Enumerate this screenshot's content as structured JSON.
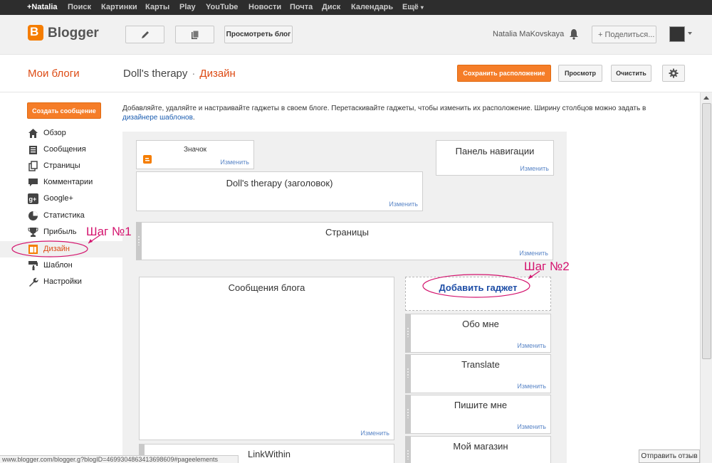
{
  "google_bar": {
    "items": [
      "+Natalia",
      "Поиск",
      "Картинки",
      "Карты",
      "Play",
      "YouTube",
      "Новости",
      "Почта",
      "Диск",
      "Календарь",
      "Ещё"
    ]
  },
  "header": {
    "logo_letter": "B",
    "logo_text": "Blogger",
    "view_blog_label": "Просмотреть блог",
    "user_name": "Natalia MaKovskaya",
    "share_label": "+ Поделиться..."
  },
  "title_row": {
    "my_blogs": "Мои блоги",
    "blog_name": "Doll's therapy",
    "separator": "·",
    "page_name": "Дизайн",
    "save_layout": "Сохранить расположение",
    "preview": "Просмотр",
    "clear": "Очистить"
  },
  "sidebar": {
    "create_post": "Создать сообщение",
    "items": [
      {
        "label": "Обзор",
        "icon": "home-icon"
      },
      {
        "label": "Сообщения",
        "icon": "posts-icon"
      },
      {
        "label": "Страницы",
        "icon": "pages-icon"
      },
      {
        "label": "Комментарии",
        "icon": "comments-icon"
      },
      {
        "label": "Google+",
        "icon": "google-plus-icon"
      },
      {
        "label": "Статистика",
        "icon": "stats-icon"
      },
      {
        "label": "Прибыль",
        "icon": "trophy-icon"
      },
      {
        "label": "Дизайн",
        "icon": "layout-icon"
      },
      {
        "label": "Шаблон",
        "icon": "template-icon"
      },
      {
        "label": "Настройки",
        "icon": "wrench-icon"
      }
    ]
  },
  "main": {
    "intro_text": "Добавляйте, удаляйте и настраивайте гаджеты в своем блоге. Перетаскивайте гаджеты, чтобы изменить их расположение. Ширину столбцов можно задать в ",
    "intro_link": "дизайнере шаблонов",
    "intro_end": ".",
    "edit_label": "Изменить",
    "gadgets": {
      "favicon": "Значок",
      "navbar": "Панель навигации",
      "header": "Doll's therapy (заголовок)",
      "pages": "Страницы",
      "blog_posts": "Сообщения блога",
      "linkwithin": "LinkWithin",
      "add_gadget": "Добавить гаджет",
      "about_me": "Обо мне",
      "translate": "Translate",
      "contact": "Пишите мне",
      "my_shop": "Мой магазин"
    },
    "annotations": {
      "step1": "Шаг №1",
      "step2": "Шаг №2"
    }
  },
  "status_bar": "www.blogger.com/blogger.g?blogID=4699304863413698609#pageelements",
  "feedback_label": "Отправить отзыв",
  "colors": {
    "accent_orange": "#f57d28",
    "annotation_magenta": "#d4146e",
    "link_blue": "#1d4da6"
  }
}
